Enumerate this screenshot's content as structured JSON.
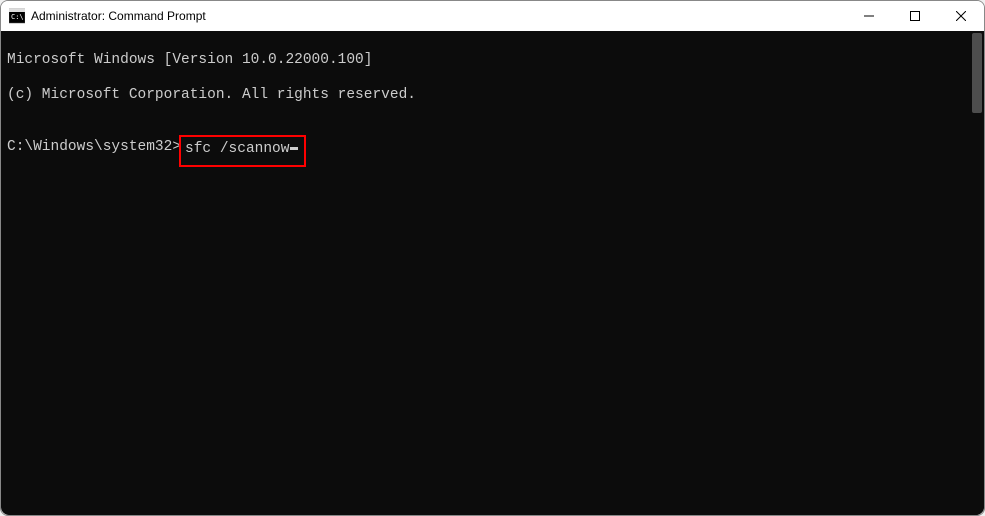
{
  "titlebar": {
    "title": "Administrator: Command Prompt"
  },
  "terminal": {
    "line1": "Microsoft Windows [Version 10.0.22000.100]",
    "line2": "(c) Microsoft Corporation. All rights reserved.",
    "blank": "",
    "prompt": "C:\\Windows\\system32>",
    "command": "sfc /scannow"
  }
}
